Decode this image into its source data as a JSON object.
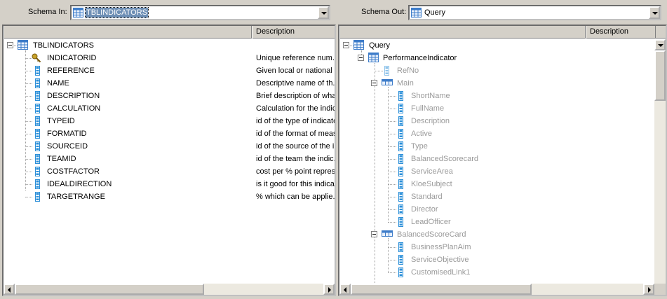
{
  "left": {
    "schema_label": "Schema In:",
    "schema_value": "TBLINDICATORS",
    "description_header": "Description",
    "root": "TBLINDICATORS",
    "fields": [
      {
        "name": "INDICATORID",
        "icon": "key-icon",
        "desc": "Unique reference num..."
      },
      {
        "name": "REFERENCE",
        "icon": "field-icon",
        "desc": "Given local or national ..."
      },
      {
        "name": "NAME",
        "icon": "field-icon",
        "desc": "Descriptive name of th..."
      },
      {
        "name": "DESCRIPTION",
        "icon": "field-icon",
        "desc": "Brief description of wha"
      },
      {
        "name": "CALCULATION",
        "icon": "field-icon",
        "desc": "Calculation for the indic"
      },
      {
        "name": "TYPEID",
        "icon": "field-icon",
        "desc": "id of the type of indicato"
      },
      {
        "name": "FORMATID",
        "icon": "field-icon",
        "desc": "id of the format of meas"
      },
      {
        "name": "SOURCEID",
        "icon": "field-icon",
        "desc": "id of the source of the i..."
      },
      {
        "name": "TEAMID",
        "icon": "field-icon",
        "desc": "id of the team the indic..."
      },
      {
        "name": "COSTFACTOR",
        "icon": "field-icon",
        "desc": "cost per % point repres..."
      },
      {
        "name": "IDEALDIRECTION",
        "icon": "field-icon",
        "desc": "is it good for this indicat"
      },
      {
        "name": "TARGETRANGE",
        "icon": "field-icon",
        "desc": "% which can be applie..."
      }
    ]
  },
  "right": {
    "schema_label": "Schema Out:",
    "schema_value": "Query",
    "description_header": "Description",
    "root": "Query",
    "node1": "PerformanceIndicator",
    "refno": "RefNo",
    "main": "Main",
    "main_fields": [
      "ShortName",
      "FullName",
      "Description",
      "Active",
      "Type",
      "BalancedScorecard",
      "ServiceArea",
      "KloeSubject",
      "Standard",
      "Director",
      "LeadOfficer"
    ],
    "bsc": "BalancedScoreCard",
    "bsc_fields": [
      "BusinessPlanAim",
      "ServiceObjective",
      "CustomisedLink1"
    ]
  },
  "colors": {
    "field_icon": "#2b8fd8",
    "table_icon": "#3d7cc9",
    "key_icon": "#c8a228",
    "selection": "#6e8fb5"
  }
}
